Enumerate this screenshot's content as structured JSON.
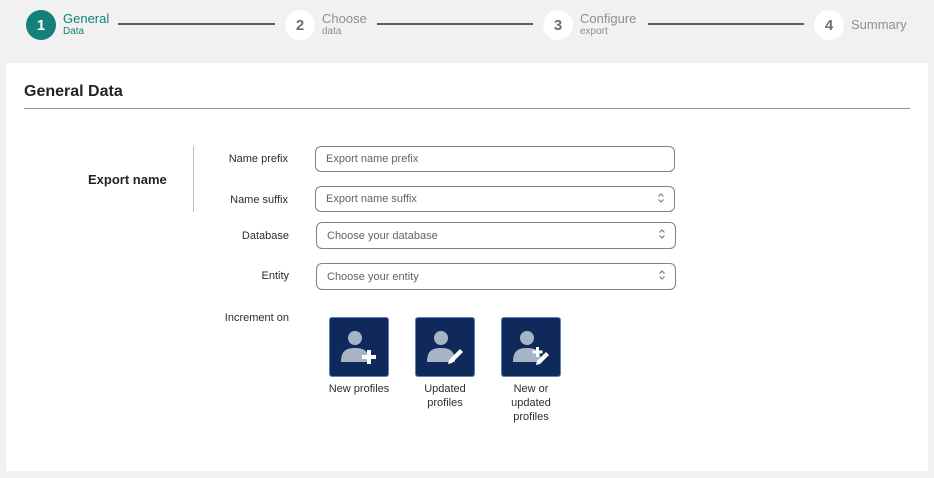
{
  "stepper": {
    "steps": [
      {
        "number": "1",
        "title": "General",
        "subtitle": "Data"
      },
      {
        "number": "2",
        "title": "Choose",
        "subtitle": "data"
      },
      {
        "number": "3",
        "title": "Configure",
        "subtitle": "export"
      },
      {
        "number": "4",
        "title": "Summary",
        "subtitle": ""
      }
    ]
  },
  "form": {
    "title": "General Data",
    "section_label": "Export name",
    "fields": {
      "name_prefix": {
        "label": "Name prefix",
        "placeholder": "Export name prefix"
      },
      "name_suffix": {
        "label": "Name suffix",
        "placeholder": "Export name suffix"
      },
      "database": {
        "label": "Database",
        "placeholder": "Choose your database"
      },
      "entity": {
        "label": "Entity",
        "placeholder": "Choose your entity"
      }
    },
    "increment": {
      "label": "Increment on",
      "options": [
        {
          "label": "New profiles",
          "icon": "user-add-icon"
        },
        {
          "label": "Updated profiles",
          "icon": "user-edit-icon"
        },
        {
          "label": "New or updated profiles",
          "icon": "user-add-edit-icon"
        }
      ]
    }
  },
  "colors": {
    "accent": "#138079",
    "tile": "#0f2a5a",
    "background": "#f0f1f0"
  }
}
